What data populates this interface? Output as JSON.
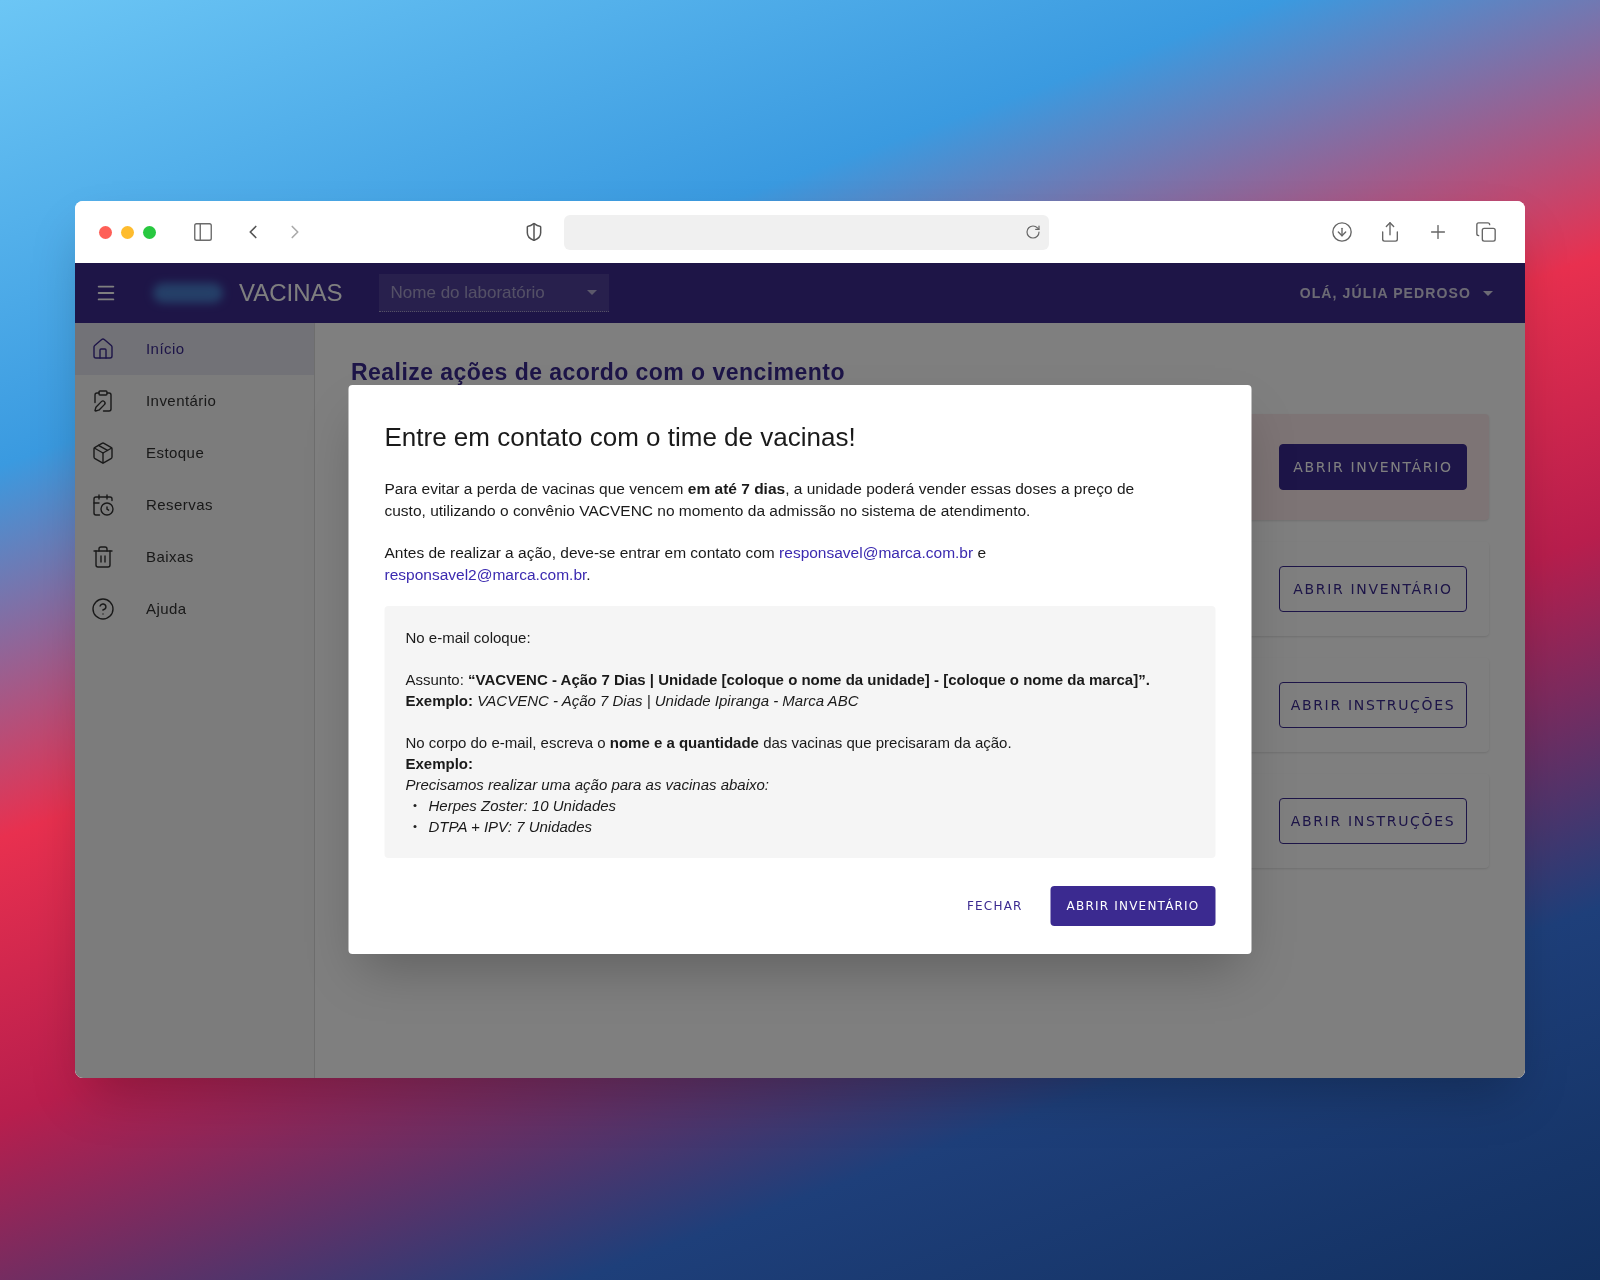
{
  "header": {
    "brand": "VACINAS",
    "lab_select": {
      "placeholder": "Nome do laboratório"
    },
    "user_menu": "OLÁ, JÚLIA PEDROSO"
  },
  "sidebar": {
    "items": [
      {
        "label": "Início",
        "selected": true
      },
      {
        "label": "Inventário",
        "selected": false
      },
      {
        "label": "Estoque",
        "selected": false
      },
      {
        "label": "Reservas",
        "selected": false
      },
      {
        "label": "Baixas",
        "selected": false
      },
      {
        "label": "Ajuda",
        "selected": false
      }
    ]
  },
  "page": {
    "title": "Realize ações de acordo com o vencimento",
    "cards": [
      {
        "highlighted": true,
        "button": {
          "label": "ABRIR INVENTÁRIO",
          "kind": "contained"
        }
      },
      {
        "highlighted": false,
        "button": {
          "label": "ABRIR INVENTÁRIO",
          "kind": "outlined"
        }
      },
      {
        "highlighted": false,
        "button": {
          "label": "ABRIR INSTRUÇÕES",
          "kind": "outlined"
        }
      },
      {
        "highlighted": false,
        "button": {
          "label": "ABRIR INSTRUÇÕES",
          "kind": "outlined"
        }
      }
    ]
  },
  "dialog": {
    "title": "Entre em contato com o time de vacinas!",
    "paragraphs": [
      [
        {
          "kind": "text",
          "text": "Para evitar a perda de vacinas que vencem **em até 7 dias**, a unidade poderá vender essas doses a preço de custo, utilizando o convênio VACVENC no momento da admissão no sistema de atendimento."
        }
      ],
      [
        {
          "kind": "text",
          "text": "Antes de realizar a ação, deve-se entrar em contato com "
        },
        {
          "kind": "link",
          "text": "responsavel@marca.com.br"
        },
        {
          "kind": "text",
          "text": " e "
        },
        {
          "kind": "link",
          "text": "responsavel2@marca.com.br"
        },
        {
          "kind": "text",
          "text": "."
        }
      ]
    ],
    "note": {
      "blocks": [
        [
          {
            "kind": "plain",
            "text": "No e-mail coloque:"
          }
        ],
        [
          {
            "kind": "plain",
            "text": "Assunto: **“VACVENC - Ação 7 Dias | Unidade [coloque o nome da unidade] - [coloque o nome da marca]”.**"
          },
          {
            "kind": "plain",
            "text": "**Exemplo:** *VACVENC - Ação 7 Dias | Unidade Ipiranga - Marca ABC*"
          }
        ],
        [
          {
            "kind": "plain",
            "text": "No corpo do e-mail, escreva o **nome e a quantidade** das vacinas que precisaram da ação."
          },
          {
            "kind": "bold",
            "text": "Exemplo:"
          },
          {
            "kind": "italic",
            "text": "Precisamos realizar uma ação para as vacinas abaixo:"
          },
          {
            "kind": "bullet",
            "text": "Herpes Zoster: 10 Unidades"
          },
          {
            "kind": "bullet",
            "text": "DTPA + IPV: 7 Unidades"
          }
        ]
      ]
    },
    "actions": [
      {
        "label": "FECHAR",
        "kind": "text"
      },
      {
        "label": "ABRIR INVENTÁRIO",
        "kind": "contained"
      }
    ]
  }
}
